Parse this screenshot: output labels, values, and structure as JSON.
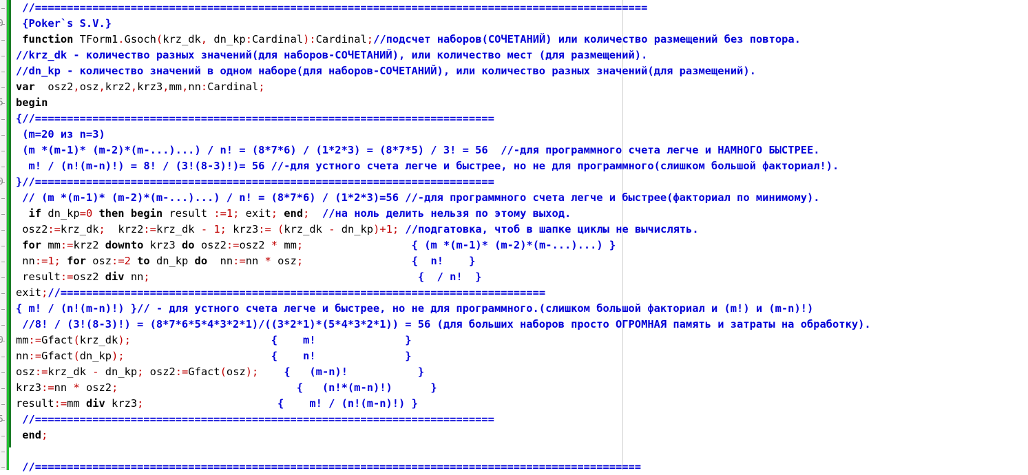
{
  "gutter": {
    "numbers": [
      {
        "line": 2,
        "text": "0"
      },
      {
        "line": 7,
        "text": "5"
      },
      {
        "line": 12,
        "text": "0"
      },
      {
        "line": 27,
        "text": "5"
      },
      {
        "line": 22,
        "text": "0"
      }
    ]
  },
  "editor": {
    "lines": [
      [
        {
          "c": "cm",
          "t": " //================================================================================================"
        }
      ],
      [
        {
          "c": "cm",
          "t": " {Poker`s S.V.}"
        }
      ],
      [
        {
          "c": "kw",
          "t": " function"
        },
        {
          "c": "id",
          "t": " TForm1"
        },
        {
          "c": "sym",
          "t": "."
        },
        {
          "c": "id",
          "t": "Gsoch"
        },
        {
          "c": "sym",
          "t": "("
        },
        {
          "c": "id",
          "t": "krz_dk"
        },
        {
          "c": "sym",
          "t": ", "
        },
        {
          "c": "id",
          "t": "dn_kp"
        },
        {
          "c": "sym",
          "t": ":"
        },
        {
          "c": "id",
          "t": "Cardinal"
        },
        {
          "c": "sym",
          "t": "):"
        },
        {
          "c": "id",
          "t": "Cardinal"
        },
        {
          "c": "sym",
          "t": ";"
        },
        {
          "c": "cm",
          "t": "//подсчет наборов(СОЧЕТАНИЙ) или количество размещений без повтора."
        }
      ],
      [
        {
          "c": "cm",
          "t": "//krz_dk - количество разных значений(для наборов-СОЧЕТАНИЙ), или количество мест (для размещений)."
        }
      ],
      [
        {
          "c": "cm",
          "t": "//dn_kp - количество значений в одном наборе(для наборов-СОЧЕТАНИЙ), или количество разных значений(для размещений)."
        }
      ],
      [
        {
          "c": "kw",
          "t": "var"
        },
        {
          "c": "id",
          "t": "  osz2"
        },
        {
          "c": "sym",
          "t": ","
        },
        {
          "c": "id",
          "t": "osz"
        },
        {
          "c": "sym",
          "t": ","
        },
        {
          "c": "id",
          "t": "krz2"
        },
        {
          "c": "sym",
          "t": ","
        },
        {
          "c": "id",
          "t": "krz3"
        },
        {
          "c": "sym",
          "t": ","
        },
        {
          "c": "id",
          "t": "mm"
        },
        {
          "c": "sym",
          "t": ","
        },
        {
          "c": "id",
          "t": "nn"
        },
        {
          "c": "sym",
          "t": ":"
        },
        {
          "c": "id",
          "t": "Cardinal"
        },
        {
          "c": "sym",
          "t": ";"
        }
      ],
      [
        {
          "c": "kw",
          "t": "begin"
        }
      ],
      [
        {
          "c": "cm",
          "t": "{//========================================================================"
        }
      ],
      [
        {
          "c": "cm",
          "t": " (m=20 из n=3)"
        }
      ],
      [
        {
          "c": "cm",
          "t": " (m *(m-1)* (m-2)*(m-...)...) / n! = (8*7*6) / (1*2*3) = (8*7*5) / 3! = 56  //-для программного счета легче и НАМНОГО БЫСТРЕЕ."
        }
      ],
      [
        {
          "c": "cm",
          "t": "  m! / (n!(m-n)!) = 8! / (3!(8-3)!)= 56 //-для устного счета легче и быстрее, но не для программного(слишком большой факториал!)."
        }
      ],
      [
        {
          "c": "cm",
          "t": "}//========================================================================"
        }
      ],
      [
        {
          "c": "cm",
          "t": " // (m *(m-1)* (m-2)*(m-...)...) / n! = (8*7*6) / (1*2*3)=56 //-для программного счета легче и быстрее(факториал по минимому)."
        }
      ],
      [
        {
          "c": "kw",
          "t": "  if"
        },
        {
          "c": "id",
          "t": " dn_kp"
        },
        {
          "c": "sym",
          "t": "=0 "
        },
        {
          "c": "kw",
          "t": "then begin"
        },
        {
          "c": "id",
          "t": " result"
        },
        {
          "c": "sym",
          "t": " :=1; "
        },
        {
          "c": "id",
          "t": "exit"
        },
        {
          "c": "sym",
          "t": "; "
        },
        {
          "c": "kw",
          "t": "end"
        },
        {
          "c": "sym",
          "t": ";  "
        },
        {
          "c": "cm",
          "t": "//на ноль делить нельзя по этому выход."
        }
      ],
      [
        {
          "c": "id",
          "t": " osz2"
        },
        {
          "c": "sym",
          "t": ":="
        },
        {
          "c": "id",
          "t": "krz_dk"
        },
        {
          "c": "sym",
          "t": ";  "
        },
        {
          "c": "id",
          "t": "krz2"
        },
        {
          "c": "sym",
          "t": ":="
        },
        {
          "c": "id",
          "t": "krz_dk"
        },
        {
          "c": "sym",
          "t": " - 1; "
        },
        {
          "c": "id",
          "t": "krz3"
        },
        {
          "c": "sym",
          "t": ":= ("
        },
        {
          "c": "id",
          "t": "krz_dk"
        },
        {
          "c": "sym",
          "t": " - "
        },
        {
          "c": "id",
          "t": "dn_kp"
        },
        {
          "c": "sym",
          "t": ")+1; "
        },
        {
          "c": "cm",
          "t": "//подгатовка, чтоб в шапке циклы не вычислять."
        }
      ],
      [
        {
          "c": "kw",
          "t": " for"
        },
        {
          "c": "id",
          "t": " mm"
        },
        {
          "c": "sym",
          "t": ":="
        },
        {
          "c": "id",
          "t": "krz2 "
        },
        {
          "c": "kw",
          "t": "downto"
        },
        {
          "c": "id",
          "t": " krz3 "
        },
        {
          "c": "kw",
          "t": "do"
        },
        {
          "c": "id",
          "t": " osz2"
        },
        {
          "c": "sym",
          "t": ":="
        },
        {
          "c": "id",
          "t": "osz2"
        },
        {
          "c": "sym",
          "t": " * "
        },
        {
          "c": "id",
          "t": "mm"
        },
        {
          "c": "sym",
          "t": ";                 "
        },
        {
          "c": "cm",
          "t": "{ (m *(m-1)* (m-2)*(m-...)...) }"
        }
      ],
      [
        {
          "c": "id",
          "t": " nn"
        },
        {
          "c": "sym",
          "t": ":=1; "
        },
        {
          "c": "kw",
          "t": "for"
        },
        {
          "c": "id",
          "t": " osz"
        },
        {
          "c": "sym",
          "t": ":=2 "
        },
        {
          "c": "kw",
          "t": "to"
        },
        {
          "c": "id",
          "t": " dn_kp "
        },
        {
          "c": "kw",
          "t": "do"
        },
        {
          "c": "id",
          "t": "  nn"
        },
        {
          "c": "sym",
          "t": ":="
        },
        {
          "c": "id",
          "t": "nn"
        },
        {
          "c": "sym",
          "t": " * "
        },
        {
          "c": "id",
          "t": "osz"
        },
        {
          "c": "sym",
          "t": ";                 "
        },
        {
          "c": "cm",
          "t": "{  n!    }"
        }
      ],
      [
        {
          "c": "id",
          "t": " result"
        },
        {
          "c": "sym",
          "t": ":="
        },
        {
          "c": "id",
          "t": "osz2 "
        },
        {
          "c": "kw",
          "t": "div"
        },
        {
          "c": "id",
          "t": " nn"
        },
        {
          "c": "sym",
          "t": ";                                          "
        },
        {
          "c": "cm",
          "t": "{  / n!  }"
        }
      ],
      [
        {
          "c": "id",
          "t": "exit"
        },
        {
          "c": "sym",
          "t": ";"
        },
        {
          "c": "cm",
          "t": "//============================================================================"
        }
      ],
      [
        {
          "c": "cm",
          "t": "{ m! / (n!(m-n)!) }// - для устного счета легче и быстрее, но не для программного.(слишком большой факториал и (m!) и (m-n)!)"
        }
      ],
      [
        {
          "c": "cm",
          "t": " //8! / (3!(8-3)!) = (8*7*6*5*4*3*2*1)/((3*2*1)*(5*4*3*2*1)) = 56 (для больших наборов просто ОГРОМНАЯ память и затраты на обработку)."
        }
      ],
      [
        {
          "c": "id",
          "t": "mm"
        },
        {
          "c": "sym",
          "t": ":="
        },
        {
          "c": "id",
          "t": "Gfact"
        },
        {
          "c": "sym",
          "t": "("
        },
        {
          "c": "id",
          "t": "krz_dk"
        },
        {
          "c": "sym",
          "t": ");                      "
        },
        {
          "c": "cm",
          "t": "{    m!              }"
        }
      ],
      [
        {
          "c": "id",
          "t": "nn"
        },
        {
          "c": "sym",
          "t": ":="
        },
        {
          "c": "id",
          "t": "Gfact"
        },
        {
          "c": "sym",
          "t": "("
        },
        {
          "c": "id",
          "t": "dn_kp"
        },
        {
          "c": "sym",
          "t": ");                       "
        },
        {
          "c": "cm",
          "t": "{    n!              }"
        }
      ],
      [
        {
          "c": "id",
          "t": "osz"
        },
        {
          "c": "sym",
          "t": ":="
        },
        {
          "c": "id",
          "t": "krz_dk"
        },
        {
          "c": "sym",
          "t": " - "
        },
        {
          "c": "id",
          "t": "dn_kp"
        },
        {
          "c": "sym",
          "t": "; "
        },
        {
          "c": "id",
          "t": "osz2"
        },
        {
          "c": "sym",
          "t": ":="
        },
        {
          "c": "id",
          "t": "Gfact"
        },
        {
          "c": "sym",
          "t": "("
        },
        {
          "c": "id",
          "t": "osz"
        },
        {
          "c": "sym",
          "t": ");    "
        },
        {
          "c": "cm",
          "t": "{   (m-n)!           }"
        }
      ],
      [
        {
          "c": "id",
          "t": "krz3"
        },
        {
          "c": "sym",
          "t": ":="
        },
        {
          "c": "id",
          "t": "nn"
        },
        {
          "c": "sym",
          "t": " * "
        },
        {
          "c": "id",
          "t": "osz2"
        },
        {
          "c": "sym",
          "t": ";                            "
        },
        {
          "c": "cm",
          "t": "{   (n!*(m-n)!)      }"
        }
      ],
      [
        {
          "c": "id",
          "t": "result"
        },
        {
          "c": "sym",
          "t": ":="
        },
        {
          "c": "id",
          "t": "mm "
        },
        {
          "c": "kw",
          "t": "div"
        },
        {
          "c": "id",
          "t": " krz3"
        },
        {
          "c": "sym",
          "t": ";                     "
        },
        {
          "c": "cm",
          "t": "{    m! / (n!(m-n)!) }"
        }
      ],
      [
        {
          "c": "cm",
          "t": " //========================================================================"
        }
      ],
      [
        {
          "c": "kw",
          "t": " end"
        },
        {
          "c": "sym",
          "t": ";"
        }
      ],
      [],
      [
        {
          "c": "cm",
          "t": " //==============================================================================================="
        }
      ]
    ]
  }
}
